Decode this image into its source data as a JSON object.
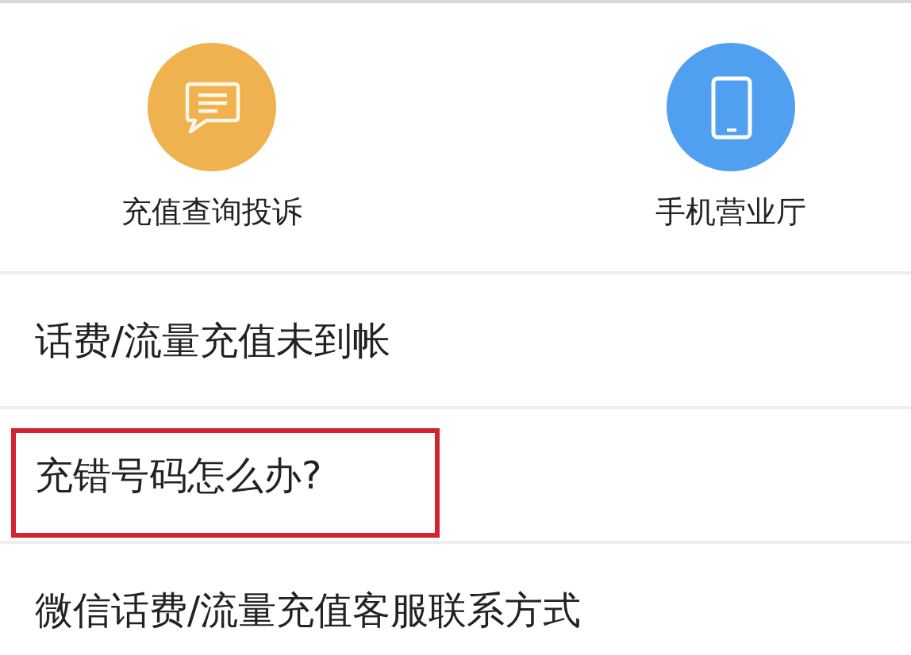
{
  "shortcuts": [
    {
      "label": "充值查询投诉",
      "kind": "chat",
      "color": "#f0b24e"
    },
    {
      "label": "手机营业厅",
      "kind": "phone",
      "color": "#519ff0"
    }
  ],
  "rows": [
    {
      "label": "话费/流量充值未到帐",
      "highlighted": false
    },
    {
      "label": "充错号码怎么办?",
      "highlighted": true
    },
    {
      "label": "微信话费/流量充值客服联系方式",
      "highlighted": false
    }
  ]
}
